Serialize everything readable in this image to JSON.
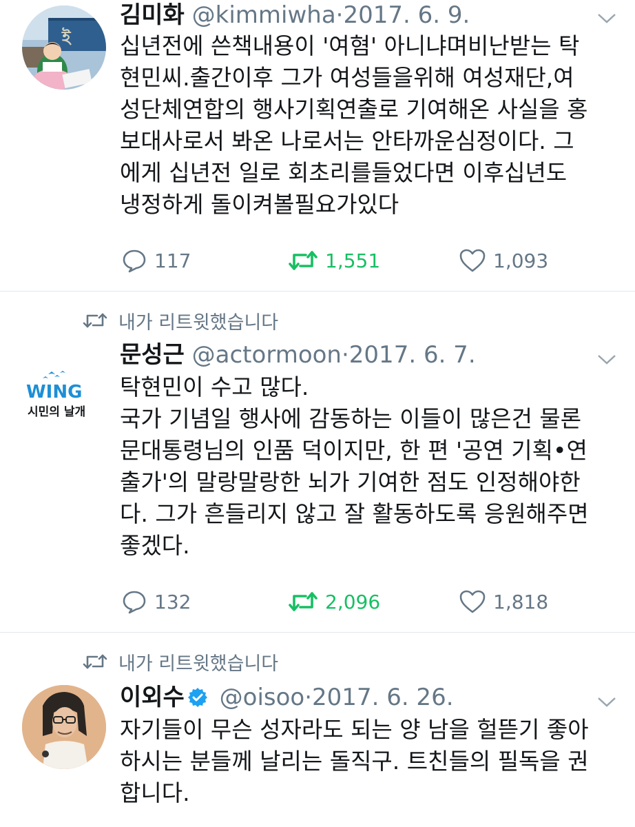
{
  "tweets": [
    {
      "name": "김미화",
      "handle": "@kimmiwha",
      "separator": "·",
      "date": "2017. 6. 9.",
      "lines": [
        "십년전에 쓴책내용이 '여혐' 아니냐며비난받는 탁",
        "현민씨.출간이후 그가 여성들을위해 여성재단,여",
        "성단체연합의 행사기획연출로 기여해온 사실을 홍",
        "보대사로서 봐온 나로서는 안타까운심정이다. 그",
        "에게 십년전 일로 회초리를들었다면 이후십년도",
        "냉정하게 돌이켜볼필요가있다"
      ],
      "replies": "117",
      "retweets": "1,551",
      "likes": "1,093",
      "retweeted": true
    },
    {
      "retweet_label": "내가 리트윗했습니다",
      "name": "문성근",
      "handle": "@actormoon",
      "separator": "·",
      "date": "2017. 6. 7.",
      "avatar_text": {
        "top": "WING",
        "bottom": "시민의 날개"
      },
      "lines": [
        "탁현민이 수고 많다.",
        "국가 기념일 행사에 감동하는 이들이 많은건 물론",
        "문대통령님의 인품 덕이지만, 한 편 '공연 기획•연",
        "출가'의 말랑말랑한 뇌가 기여한 점도 인정해야한",
        "다. 그가 흔들리지 않고 잘 활동하도록 응원해주면",
        "좋겠다."
      ],
      "replies": "132",
      "retweets": "2,096",
      "likes": "1,818",
      "retweeted": true
    },
    {
      "retweet_label": "내가 리트윗했습니다",
      "name": "이외수",
      "handle": "@oisoo",
      "separator": "·",
      "date": "2017. 6. 26.",
      "verified": true,
      "lines": [
        "자기들이 무슨 성자라도 되는 양 남을 헐뜯기 좋아",
        "하시는 분들께 날리는 돌직구. 트친들의 필독을 권",
        "합니다."
      ]
    }
  ],
  "colors": {
    "text": "#14171a",
    "secondary": "#657786",
    "retweet_active": "#17bf63",
    "divider": "#e1e8ed",
    "verified": "#1da1f2"
  },
  "icons": [
    "reply-icon",
    "retweet-icon",
    "like-icon",
    "chevron-down-icon",
    "verified-badge-icon"
  ]
}
